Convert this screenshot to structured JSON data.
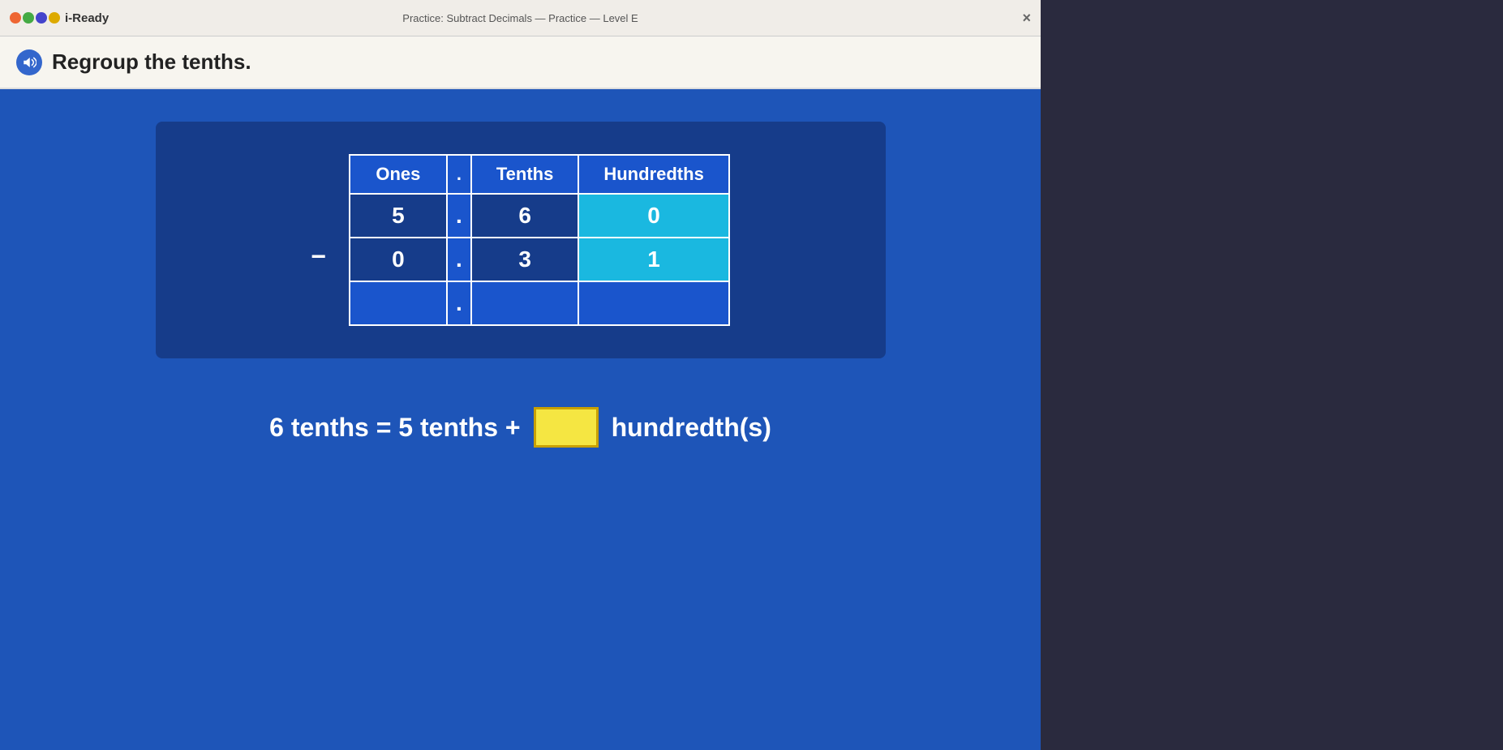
{
  "topbar": {
    "logo_text": "i-Ready",
    "page_title": "Practice: Subtract Decimals — Practice — Level E",
    "close_label": "×"
  },
  "instruction": {
    "text": "Regroup the tenths."
  },
  "table": {
    "headers": [
      "Ones",
      ".",
      "Tenths",
      "Hundredths"
    ],
    "row1": [
      "5",
      ".",
      "6",
      "0"
    ],
    "row2": [
      "0",
      ".",
      "3",
      "1"
    ],
    "row3": [
      "",
      ".",
      "",
      ""
    ]
  },
  "equation": {
    "text": "6 tenths = 5 tenths +",
    "input_placeholder": "",
    "suffix": "hundredth(s)"
  }
}
